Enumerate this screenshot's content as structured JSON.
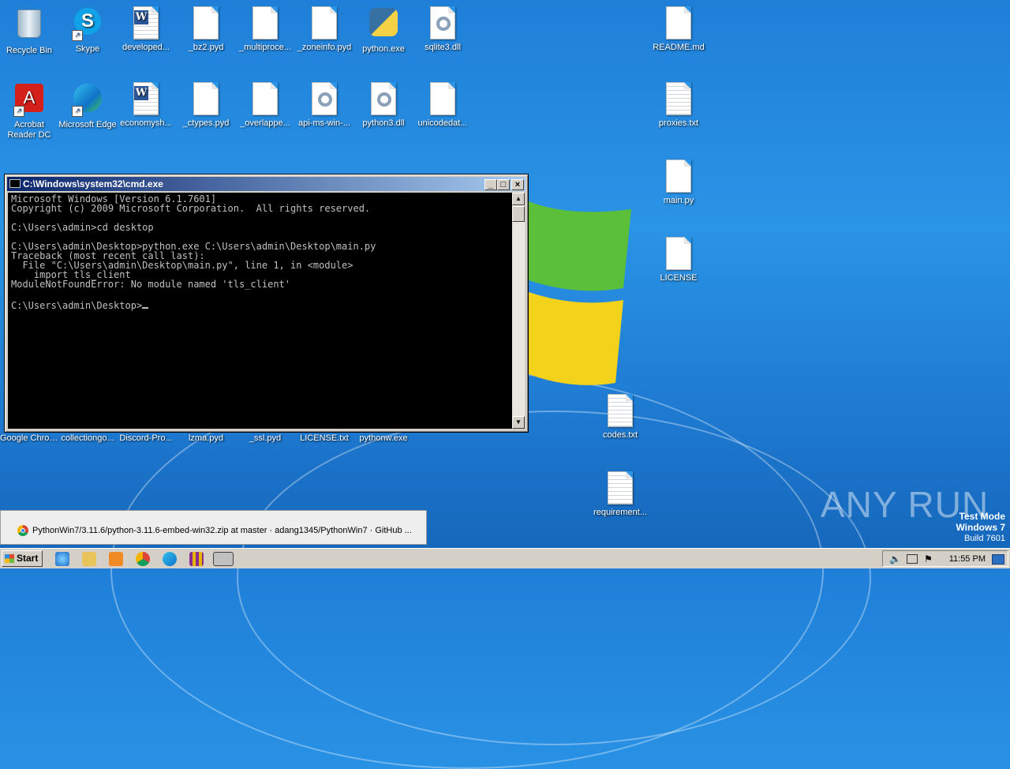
{
  "desktop": {
    "icons": [
      {
        "label": "Recycle Bin",
        "kind": "recycle"
      },
      {
        "label": "Skype",
        "kind": "skype"
      },
      {
        "label": "developed...",
        "kind": "word"
      },
      {
        "label": "_bz2.pyd",
        "kind": "doc"
      },
      {
        "label": "_multiproce...",
        "kind": "doc"
      },
      {
        "label": "_zoneinfo.pyd",
        "kind": "doc"
      },
      {
        "label": "python.exe",
        "kind": "python"
      },
      {
        "label": "sqlite3.dll",
        "kind": "gear"
      },
      {
        "label": "README.md",
        "kind": "doc"
      },
      {
        "label": "Acrobat Reader DC",
        "kind": "acrobat"
      },
      {
        "label": "Microsoft Edge",
        "kind": "edge"
      },
      {
        "label": "economysh...",
        "kind": "word"
      },
      {
        "label": "_ctypes.pyd",
        "kind": "doc"
      },
      {
        "label": "_overlappe...",
        "kind": "doc"
      },
      {
        "label": "api-ms-win-...",
        "kind": "gear"
      },
      {
        "label": "python3.dll",
        "kind": "gear"
      },
      {
        "label": "unicodedat...",
        "kind": "doc"
      },
      {
        "label": "proxies.txt",
        "kind": "txt"
      },
      {
        "label": "main.py",
        "kind": "doc"
      },
      {
        "label": "LICENSE",
        "kind": "doc"
      },
      {
        "label": "Google Chrome",
        "kind": "label"
      },
      {
        "label": "collectiongo...",
        "kind": "label"
      },
      {
        "label": "Discord-Pro...",
        "kind": "label"
      },
      {
        "label": "lzma.pyd",
        "kind": "label"
      },
      {
        "label": "_ssl.pyd",
        "kind": "label"
      },
      {
        "label": "LICENSE.txt",
        "kind": "label"
      },
      {
        "label": "pythonw.exe",
        "kind": "label"
      },
      {
        "label": "codes.txt",
        "kind": "txt"
      },
      {
        "label": "requirement...",
        "kind": "txt"
      }
    ]
  },
  "cmd": {
    "title": "C:\\Windows\\system32\\cmd.exe",
    "output": "Microsoft Windows [Version 6.1.7601]\nCopyright (c) 2009 Microsoft Corporation.  All rights reserved.\n\nC:\\Users\\admin>cd desktop\n\nC:\\Users\\admin\\Desktop>python.exe C:\\Users\\admin\\Desktop\\main.py\nTraceback (most recent call last):\n  File \"C:\\Users\\admin\\Desktop\\main.py\", line 1, in <module>\n    import tls_client\nModuleNotFoundError: No module named 'tls_client'\n\nC:\\Users\\admin\\Desktop>"
  },
  "notification": {
    "text": "PythonWin7/3.11.6/python-3.11.6-embed-win32.zip at master · adang1345/PythonWin7 · GitHub ..."
  },
  "taskbar": {
    "start_label": "Start",
    "clock": "11:55 PM"
  },
  "watermark": {
    "text": "ANY RUN"
  },
  "testmode": {
    "line1": "Test Mode",
    "line2": "Windows 7",
    "line3": "Build 7601"
  },
  "colors": {
    "titlebar_start": "#0a246a",
    "titlebar_end": "#a6caf0",
    "desktop": "#1f7fd8"
  }
}
